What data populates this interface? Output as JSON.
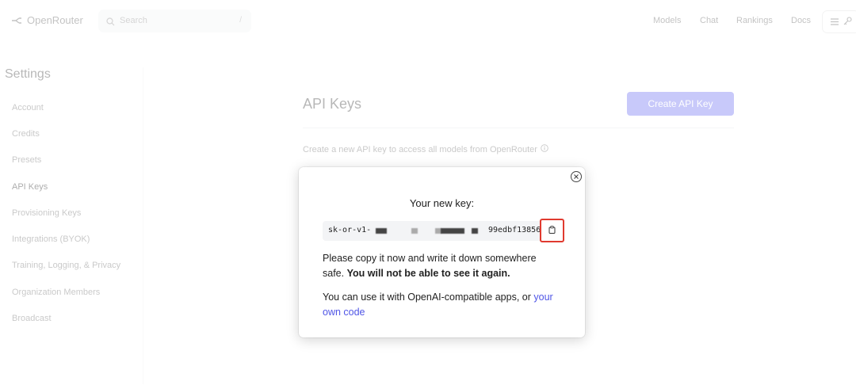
{
  "header": {
    "logo_text": "OpenRouter",
    "search_placeholder": "Search",
    "search_shortcut": "/",
    "nav": [
      "Models",
      "Chat",
      "Rankings",
      "Docs"
    ]
  },
  "sidebar": {
    "title": "Settings",
    "items": [
      {
        "label": "Account"
      },
      {
        "label": "Credits"
      },
      {
        "label": "Presets"
      },
      {
        "label": "API Keys",
        "active": true
      },
      {
        "label": "Provisioning Keys"
      },
      {
        "label": "Integrations (BYOK)"
      },
      {
        "label": "Training, Logging, & Privacy"
      },
      {
        "label": "Organization Members"
      },
      {
        "label": "Broadcast"
      }
    ]
  },
  "main": {
    "title": "API Keys",
    "create_button": "Create API Key",
    "description": "Create a new API key to access all models from OpenRouter"
  },
  "modal": {
    "heading": "Your new key:",
    "key_prefix": "sk-or-v1-",
    "key_suffix": "99edbf13856",
    "copy_notice_1": "Please copy it now and write it down somewhere safe.",
    "copy_notice_bold": "You will not be able to see it again.",
    "usage_text": "You can use it with OpenAI-compatible apps, or",
    "usage_link": "your own code"
  },
  "colors": {
    "accent": "#6366f1",
    "link": "#4f55e6",
    "highlight": "#e03a2f"
  }
}
